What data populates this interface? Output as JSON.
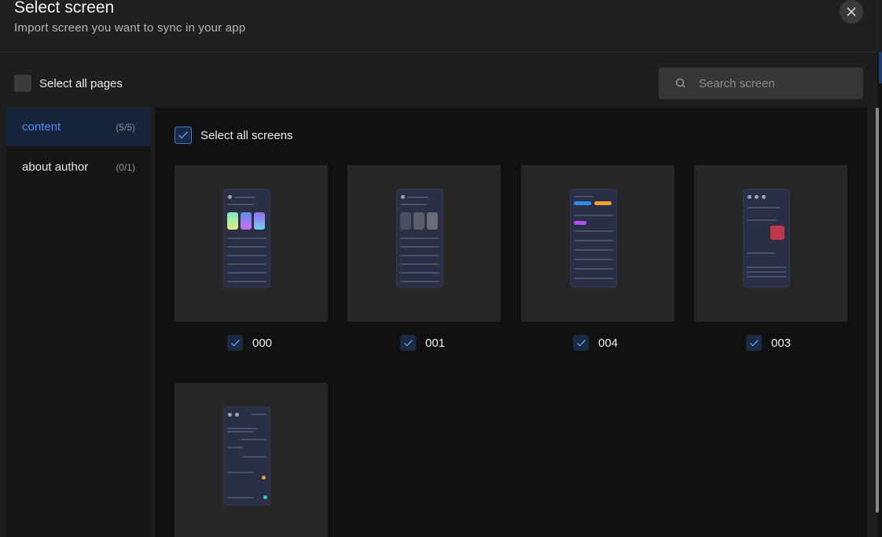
{
  "header": {
    "title": "Select screen",
    "subtitle": "Import screen you want to sync in your app"
  },
  "toolbar": {
    "select_all_pages": "Select all pages",
    "search_placeholder": "Search screen"
  },
  "sidebar": {
    "items": [
      {
        "label": "content",
        "count": "(5/5)",
        "active": true
      },
      {
        "label": "about author",
        "count": "(0/1)",
        "active": false
      }
    ]
  },
  "main": {
    "select_all_screens": "Select all screens",
    "screens": [
      {
        "name": "000",
        "checked": true
      },
      {
        "name": "001",
        "checked": true
      },
      {
        "name": "004",
        "checked": true
      },
      {
        "name": "003",
        "checked": true
      },
      {
        "name": "",
        "checked": true
      }
    ]
  },
  "colors": {
    "accent": "#3b7bdc",
    "active_text": "#4a8cf0",
    "active_bg": "#15243b"
  }
}
